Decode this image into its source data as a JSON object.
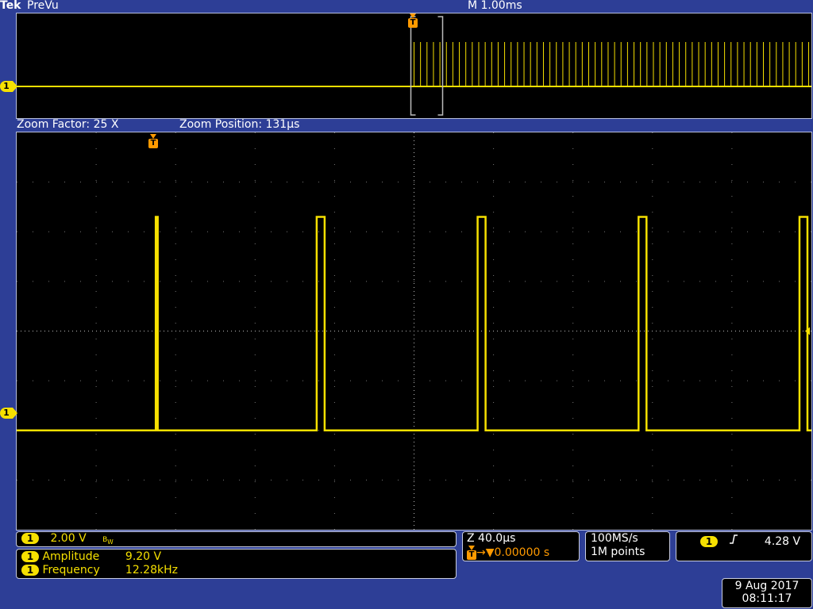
{
  "header": {
    "logo": "Tek",
    "acq_state": "PreVu",
    "main_timebase": "M 1.00ms"
  },
  "zoom": {
    "factor_label": "Zoom Factor: 25 X",
    "position_label": "Zoom Position: 131µs"
  },
  "channel": {
    "number": "1",
    "scale": "2.00 V",
    "bw_icon": "bandwidth-limit-icon",
    "color": "#f6e000"
  },
  "measurements": [
    {
      "name": "Amplitude",
      "value": "9.20 V"
    },
    {
      "name": "Frequency",
      "value": "12.28kHz"
    }
  ],
  "timebase": {
    "zoom_scale": "Z 40.0µs",
    "trigger_delay": "0.00000 s"
  },
  "acquisition": {
    "sample_rate": "100MS/s",
    "record_length": "1M points"
  },
  "trigger": {
    "source": "1",
    "slope_icon": "rising-edge-icon",
    "level": "4.28 V",
    "marker": "T"
  },
  "datetime": {
    "date": "9 Aug 2017",
    "time": "08:11:17"
  },
  "chart_data": {
    "type": "line",
    "x_unit": "µs",
    "y_unit": "V",
    "zoom_window": {
      "xlim": [
        -200,
        200
      ],
      "ylim": [
        -8,
        8
      ],
      "pulses": [
        {
          "start": -130,
          "end": -129
        },
        {
          "start": -49,
          "end": -45
        },
        {
          "start": 32,
          "end": 36
        },
        {
          "start": 113,
          "end": 117
        },
        {
          "start": 194,
          "end": 198
        }
      ],
      "low_level": -4.0,
      "high_level": 4.6
    },
    "overview": {
      "xlim": [
        -5,
        5
      ],
      "pulse_start": 0.0,
      "pulse_period": 0.0814,
      "pulse_end": 5
    }
  }
}
